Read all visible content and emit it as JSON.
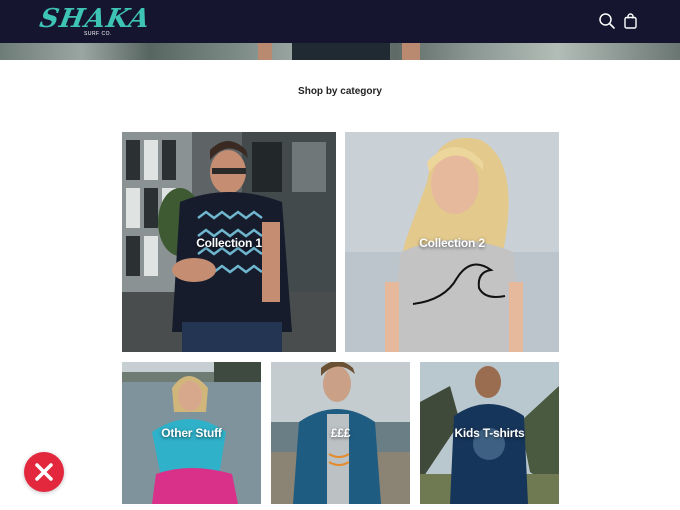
{
  "header": {
    "logo_text": "SHAKA",
    "logo_sub": "SURF CO.",
    "search_icon": "search-icon",
    "cart_icon": "shopping-bag-icon"
  },
  "section": {
    "title": "Shop by category"
  },
  "categories": [
    {
      "label": "Collection 1"
    },
    {
      "label": "Collection 2"
    },
    {
      "label": "Other Stuff"
    },
    {
      "label": "£££"
    },
    {
      "label": "Kids T-shirts"
    }
  ],
  "close_button": {
    "icon": "close-icon"
  },
  "colors": {
    "header_bg": "#151530",
    "logo": "#3ec4b4",
    "close_bg": "#e3273d"
  }
}
